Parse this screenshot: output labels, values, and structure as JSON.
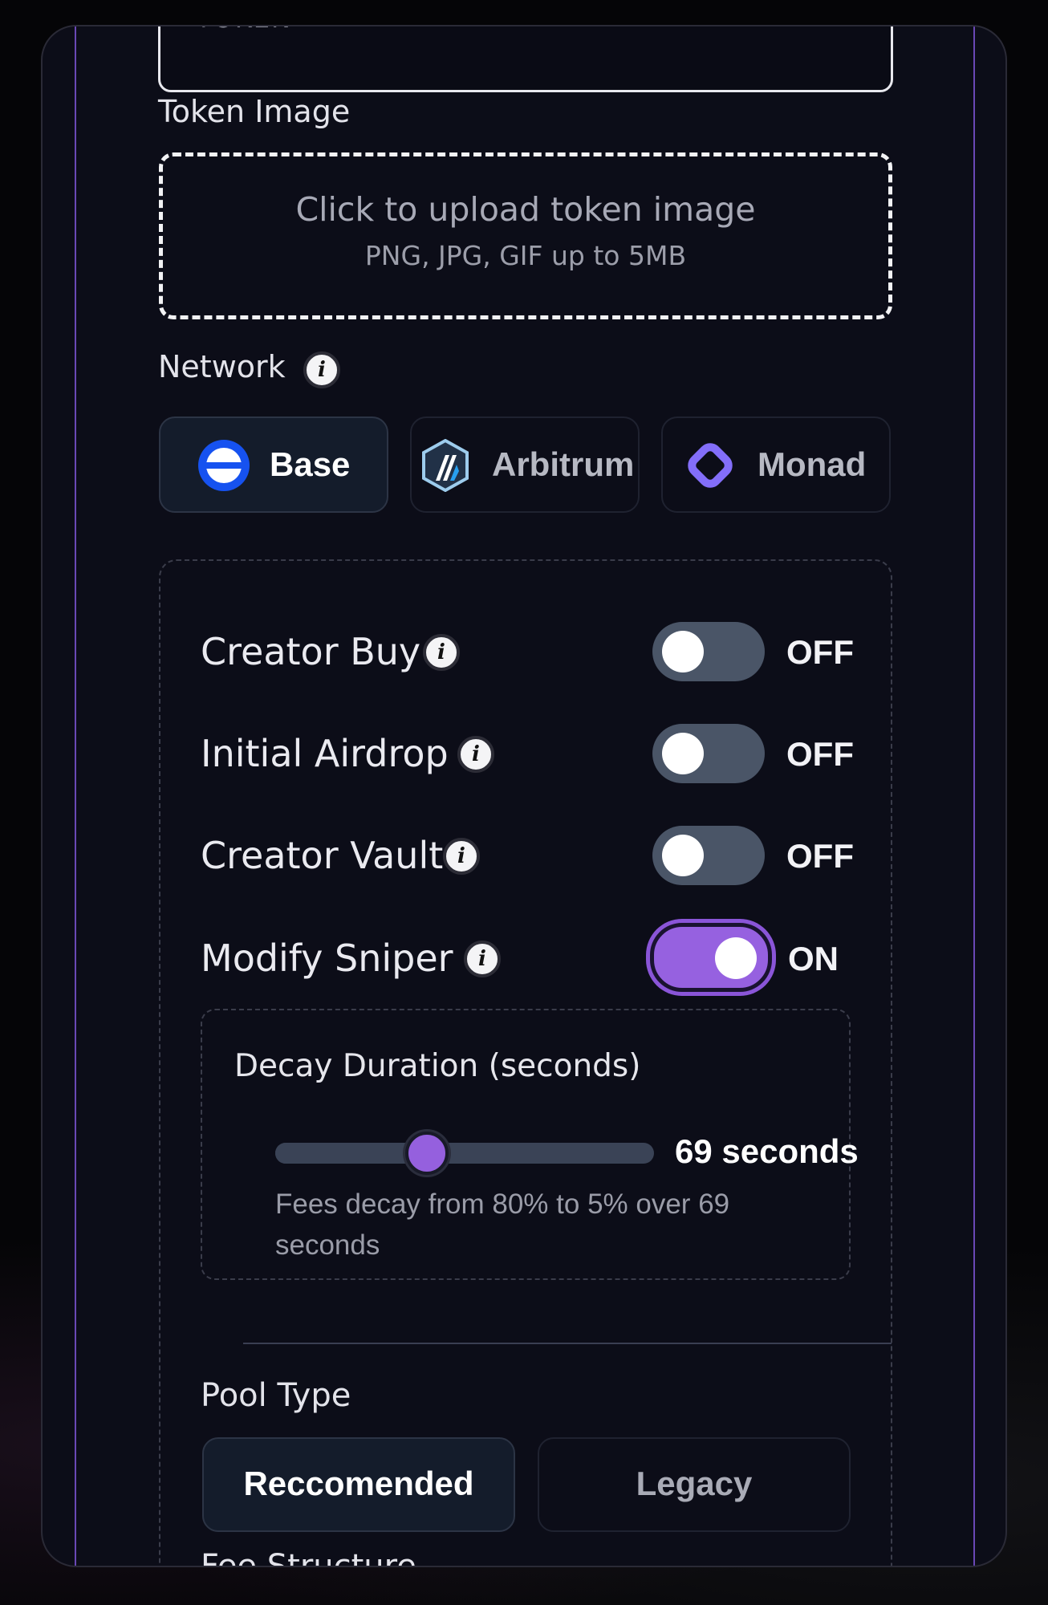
{
  "token_symbol_field": {
    "placeholder_visible": "TOKEN"
  },
  "token_image": {
    "label": "Token Image",
    "upload_title": "Click to upload token image",
    "upload_hint": "PNG, JPG, GIF up to 5MB"
  },
  "network": {
    "label": "Network",
    "options": [
      {
        "label": "Base",
        "icon": "base-logo-icon",
        "selected": true
      },
      {
        "label": "Arbitrum",
        "icon": "arbitrum-logo-icon",
        "selected": false
      },
      {
        "label": "Monad",
        "icon": "monad-logo-icon",
        "selected": false
      }
    ]
  },
  "toggles": [
    {
      "label": "Creator Buy",
      "state": "OFF"
    },
    {
      "label": "Initial Airdrop",
      "state": "OFF"
    },
    {
      "label": "Creator Vault",
      "state": "OFF"
    },
    {
      "label": "Modify Sniper",
      "state": "ON"
    }
  ],
  "decay": {
    "label": "Decay Duration (seconds)",
    "value_text": "69 seconds",
    "slider_fraction": 0.4,
    "hint_line1": "Fees decay from 80% to 5% over 69",
    "hint_line2": "seconds"
  },
  "pool_type": {
    "label": "Pool Type",
    "options": [
      {
        "label": "Reccomended",
        "selected": true
      },
      {
        "label": "Legacy",
        "selected": false
      }
    ]
  },
  "fee_structure": {
    "label": "Fee Structure"
  },
  "colors": {
    "accent": "#9661e0",
    "background": "#0c0d18",
    "base_blue": "#1652f0",
    "monad_purple": "#836ef9"
  }
}
